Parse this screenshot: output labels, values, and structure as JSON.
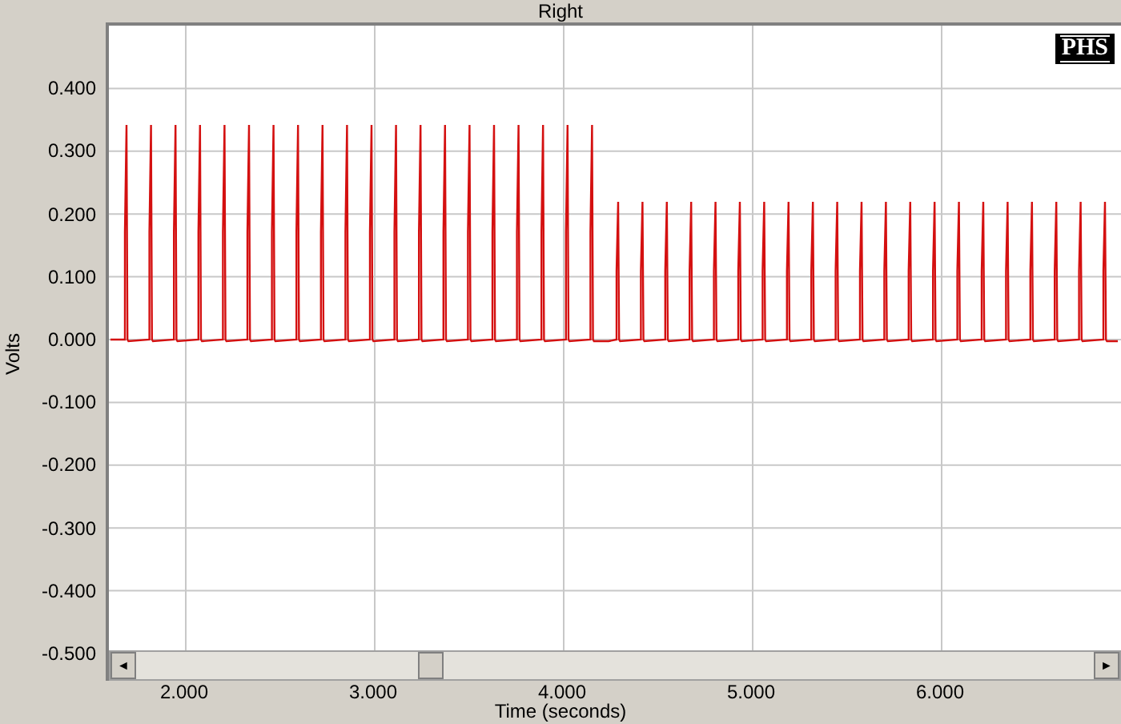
{
  "title": "Right",
  "logo": {
    "text": "PHS"
  },
  "y_axis": {
    "label": "Volts",
    "ticks": [
      "0.400",
      "0.300",
      "0.200",
      "0.100",
      "0.000",
      "-0.100",
      "-0.200",
      "-0.300",
      "-0.400",
      "-0.500"
    ]
  },
  "x_axis": {
    "label": "Time (seconds)",
    "ticks": [
      "2.000",
      "3.000",
      "4.000",
      "5.000",
      "6.000"
    ]
  },
  "scrollbar": {
    "left_arrow": "◄",
    "right_arrow": "►"
  }
}
